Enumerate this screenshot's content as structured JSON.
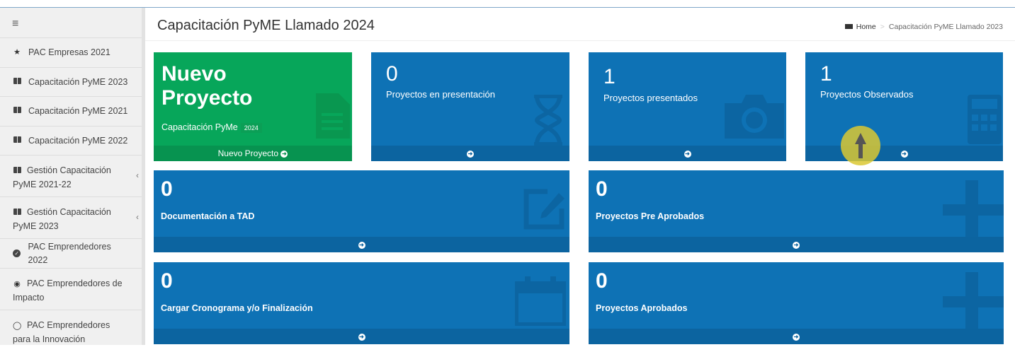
{
  "sidebar": {
    "menu_icon": "hamburger-icon",
    "items": [
      {
        "label": "PAC Empresas 2021",
        "icon": "star-icon"
      },
      {
        "label": "Capacitación PyME 2023",
        "icon": "book-icon"
      },
      {
        "label": "Capacitación PyME 2021",
        "icon": "book-icon"
      },
      {
        "label": "Capacitación PyME 2022",
        "icon": "book-icon"
      },
      {
        "label": "Gestión Capacitación PyME 2021-22",
        "icon": "book-icon",
        "expandable": true
      },
      {
        "label": "Gestión Capacitación PyME 2023",
        "icon": "book-icon",
        "expandable": true
      },
      {
        "label": "PAC Emprendedores 2022",
        "icon": "check-circle-icon"
      },
      {
        "label": "PAC Emprendedores de Impacto",
        "icon": "target-icon"
      },
      {
        "label": "PAC Emprendedores para la Innovación",
        "icon": "lightbulb-icon"
      }
    ]
  },
  "header": {
    "title": "Capacitación PyME Llamado",
    "title_year": "2024",
    "breadcrumb": {
      "home": "Home",
      "current": "Capacitación PyME Llamado 2023"
    }
  },
  "tiles": {
    "nuevo": {
      "title": "Nuevo Proyecto",
      "subtitle": "Capacitación PyMe",
      "subtitle_year": "2024",
      "footer": "Nuevo Proyecto"
    },
    "presentacion": {
      "count": "0",
      "label": "Proyectos en presentación"
    },
    "presentados": {
      "count": "1",
      "label": "Proyectos presentados"
    },
    "observados": {
      "count": "1",
      "label": "Proyectos Observados"
    },
    "tad": {
      "count": "0",
      "label": "Documentación a TAD"
    },
    "pre_aprobados": {
      "count": "0",
      "label": "Proyectos Pre Aprobados"
    },
    "cronograma": {
      "count": "0",
      "label": "Cargar Cronograma y/o Finalización"
    },
    "aprobados": {
      "count": "0",
      "label": "Proyectos Aprobados"
    }
  },
  "colors": {
    "tile_blue": "#0e72b5",
    "tile_green": "#07a65a",
    "cursor": "#dac832"
  }
}
